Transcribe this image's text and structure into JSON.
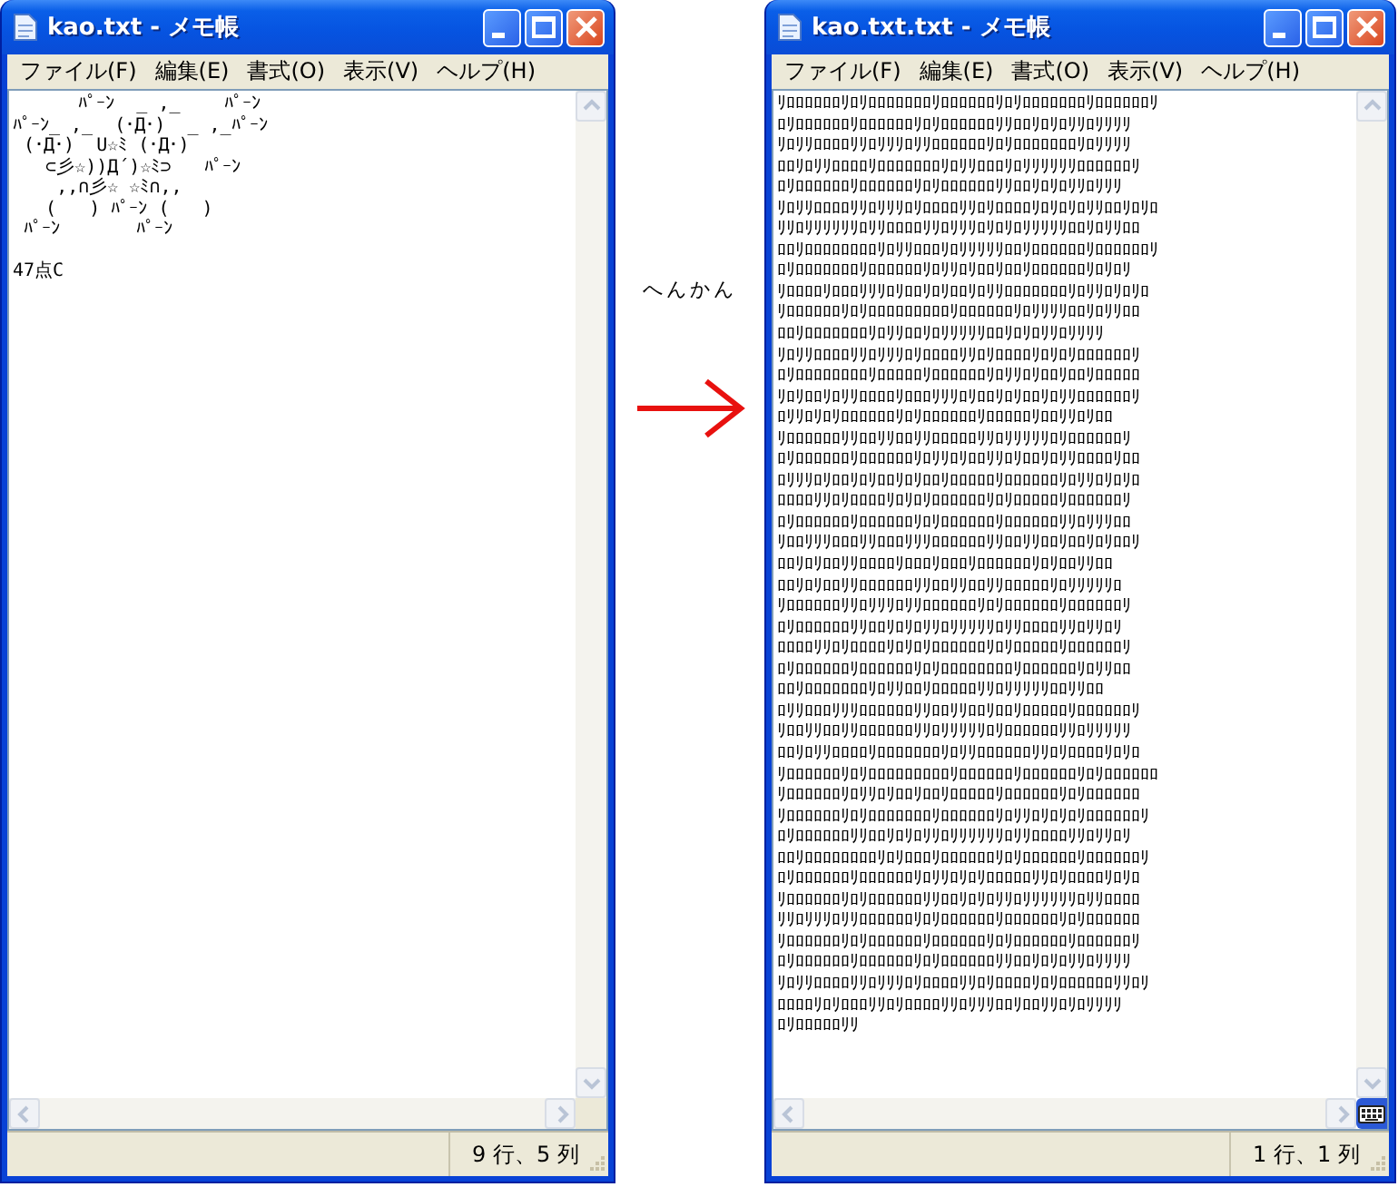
{
  "windows": [
    {
      "title": "kao.txt - メモ帳",
      "menu": [
        "ファイル(F)",
        "編集(E)",
        "書式(O)",
        "表示(V)",
        "ヘルプ(H)"
      ],
      "paragraphs": [
        [
          "      ﾊﾟｰﾝ  _ ,_    ﾊﾟｰﾝ",
          "ﾊﾟｰﾝ_ ,_  (･Д･)  _ ,_ﾊﾟｰﾝ",
          " (･Д･)  U☆ﾐ (･Д･)",
          "   ⊂彡☆))Д´)☆ﾐ⊃   ﾊﾟｰﾝ",
          "    ,,∩彡☆ ☆ﾐ∩,,",
          "   (   ) ﾊﾟｰﾝ (   )",
          " ﾊﾟｰﾝ       ﾊﾟｰﾝ"
        ],
        [
          "47点C"
        ]
      ],
      "status": "9 行、5 列",
      "language_bar": false
    },
    {
      "title": "kao.txt.txt - メモ帳",
      "menu": [
        "ファイル(F)",
        "編集(E)",
        "書式(O)",
        "表示(V)",
        "ヘルプ(H)"
      ],
      "paragraphs": [
        [
          "ﾘﾛﾛﾛﾛﾛﾛﾘﾛﾘﾛﾛﾛﾛﾛﾛﾛﾘﾛﾛﾛﾛﾛﾛﾘﾛﾘﾛﾛﾛﾛﾛﾛﾛﾘﾛﾛﾛﾛﾛﾛﾘ",
          "ﾛﾘﾛﾛﾛﾛﾛﾛﾘﾛﾛﾛﾛﾛﾛﾘﾛﾘﾛﾛﾛﾛﾛﾛﾘﾘﾛﾛﾘﾛﾘﾛﾘﾘﾛﾘﾘﾘﾘ",
          "ﾘﾛﾘﾘﾛﾛﾛﾛﾘﾘﾛﾘﾘﾘﾛﾘﾘﾛﾛﾛﾛﾛﾛﾘﾛﾘﾛﾛﾛﾛﾛﾛﾛﾘﾛﾘﾘﾘﾘ",
          "ﾛﾛﾘﾛﾘﾘﾛﾛﾛﾛﾘﾛﾛﾛﾛﾛﾛﾛﾘﾛﾘﾘﾛﾛﾛﾘﾛﾘﾘﾘﾘﾘﾘﾛﾛﾛﾛﾛﾛﾘ",
          "ﾛﾘﾛﾛﾛﾛﾛﾛﾘﾛﾛﾛﾛﾛﾛﾘﾛﾘﾛﾛﾛﾛﾛﾛﾘﾘﾛﾛﾘﾛﾘﾛﾘﾘﾛﾘﾘﾘ",
          "ﾘﾛﾘﾘﾛﾛﾛﾛﾘﾘﾛﾘﾘﾘﾛﾘﾛﾛﾛﾛﾘﾘﾛﾘﾛﾛﾛﾛﾘﾛﾘﾛﾘﾛﾘﾘﾛﾛﾘﾛﾘﾛ",
          "ﾘﾘﾛﾘﾘﾘﾘﾘﾘﾛﾘﾘﾛﾛﾛﾛﾘﾘﾛﾘﾘﾘﾛﾘﾛﾘﾛﾘﾘﾘﾘﾘﾛﾛﾘﾛﾘﾘﾛﾛ",
          "ﾛﾛﾘﾛﾛﾛﾛﾛﾛﾛﾛﾘﾛﾘﾘﾛﾛﾛﾘﾛﾘﾘﾘﾘﾘﾛﾛﾘﾛﾛﾛﾛﾛﾛﾘﾛﾛﾛﾛﾛﾛﾘ",
          "ﾛﾘﾛﾛﾛﾛﾛﾛﾛﾘﾛﾛﾛﾛﾛﾛﾘﾛﾘﾘﾛﾘﾛﾛﾘﾛﾛﾘﾛﾛﾛﾛﾛﾛﾘﾛﾘﾛﾘ",
          "ﾘﾛﾛﾛﾛﾘﾛﾛﾛﾘﾘﾘﾛﾘﾛﾛﾘﾛﾘﾛﾛﾘﾛﾘﾘﾛﾛﾛﾛﾛﾛﾛﾘﾛﾘﾘﾛﾘﾛﾘﾛ",
          "ﾘﾛﾛﾛﾛﾛﾛﾘﾛﾘﾛﾛﾛﾛﾛﾛﾛﾛﾛﾘﾛﾛﾛﾛﾛﾛﾘﾛﾘﾘﾘﾘﾛﾛﾘﾛﾘﾘﾛﾛ",
          "ﾛﾛﾘﾛﾛﾛﾛﾛﾛﾛﾘﾛﾘﾘﾛﾛﾘﾛﾘﾘﾘﾘﾘﾛﾛﾘﾛﾘﾛﾘﾘﾛﾘﾘﾘﾘ",
          "ﾘﾛﾘﾘﾛﾛﾛﾛﾘﾘﾛﾘﾘﾘﾛﾘﾛﾛﾛﾛﾘﾘﾛﾘﾛﾛﾛﾛﾘﾛﾘﾛﾘﾛﾛﾛﾛﾛﾛﾘ",
          "ﾛﾘﾛﾛﾛﾛﾛﾛﾛﾛﾘﾛﾛﾛﾛﾛﾘﾛﾛﾛﾛﾛﾛﾘﾛﾘﾘﾛﾘﾛﾛﾘﾛﾛﾘﾛﾛﾛﾛﾛ",
          "ﾘﾛﾘﾛﾛﾘﾛﾘﾘﾛﾛﾛﾛﾘﾛﾛﾛﾘﾘﾘﾛﾘﾛﾛﾘﾛﾘﾛﾛﾘﾛﾘﾘﾛﾛﾛﾛﾛﾛﾘ",
          "ﾛﾘﾘﾛﾘﾛﾘﾛﾛﾛﾛﾛﾛﾘﾛﾘﾛﾛﾛﾛﾛﾛﾘﾛﾛﾛﾛﾛﾘﾛﾛﾘﾘﾛﾘﾛﾛ",
          "ﾘﾛﾛﾛﾛﾛﾛﾘﾘﾛﾛﾘﾘﾛﾛﾘﾘﾛﾛﾛﾛﾛﾘﾘﾛﾘﾘﾘﾘﾘﾛﾘﾛﾛﾛﾛﾛﾛﾘ",
          "ﾛﾘﾛﾛﾛﾛﾛﾛﾘﾛﾛﾛﾛﾛﾛﾘﾛﾘﾘﾛﾘﾛﾛﾘﾘﾛﾘﾛﾛﾘﾛﾘﾘﾛﾛﾛﾛﾘﾛﾛ",
          "ﾛﾘﾘﾘﾛﾘﾛﾛﾘﾛﾘﾛﾛﾘﾛﾘﾛﾛﾘﾛﾛﾛﾛﾛﾘﾛﾛﾛﾛﾛﾛﾘﾛﾘﾘﾛﾘﾛﾘﾛ",
          "ﾛﾛﾛﾛﾘﾘﾛﾘﾛﾛﾛﾛﾘﾛﾘﾛﾘﾛﾛﾛﾛﾛﾛﾘﾛﾘﾛﾛﾛﾛﾛﾘﾛﾛﾛﾛﾛﾛﾘ",
          "ﾛﾘﾛﾛﾛﾛﾛﾛﾘﾛﾛﾛﾛﾛﾛﾘﾛﾘﾛﾛﾛﾛﾛﾛﾘﾛﾛﾛﾛﾛﾛﾘﾘﾛﾘﾘﾘﾛﾛ",
          "ﾘﾛﾛﾘﾘﾘﾛﾛﾛﾘﾘﾛﾛﾛﾘﾘﾘﾛﾛﾛﾛﾛﾛﾘﾘﾛﾛﾘﾘﾛﾛﾘﾛﾛﾘﾛﾘﾛﾛﾘ",
          "ﾛﾛﾘﾛﾘﾛﾛﾘﾘﾛﾛﾛﾛﾘﾛﾛﾛﾘﾛﾛﾛﾘﾛﾛﾛﾛﾛﾛﾘﾛﾘﾛﾛﾘﾘﾛﾛ",
          "ﾛﾛﾘﾛﾘﾛﾛﾘﾘﾛﾛﾛﾛﾛﾛﾘﾘﾛﾛﾘﾘﾛﾛﾘﾘﾛﾛﾛﾛﾛﾘﾛﾘﾘﾘﾘﾘﾛ",
          "ﾘﾛﾛﾛﾛﾛﾛﾘﾘﾛﾘﾘﾘﾛﾘﾘﾛﾛﾛﾛﾛﾛﾘﾛﾘﾛﾛﾛﾛﾛﾛﾘﾛﾛﾛﾛﾛﾛﾘ",
          "ﾛﾘﾛﾛﾛﾛﾛﾛﾘﾘﾛﾛﾘﾛﾘﾛﾘﾘﾛﾘﾘﾘﾘﾘﾛﾘﾘﾛﾛﾛﾛﾘﾘﾛﾘﾘﾛﾘ",
          "ﾛﾛﾛﾛﾘﾘﾛﾘﾛﾛﾛﾛﾘﾛﾘﾛﾘﾛﾛﾛﾛﾛﾛﾘﾛﾘﾛﾛﾛﾛﾛﾘﾛﾛﾛﾛﾛﾛﾘ",
          "ﾛﾘﾛﾛﾛﾛﾛﾛﾘﾛﾛﾛﾛﾛﾛﾘﾛﾘﾛﾛﾛﾛﾛﾛﾛﾛﾘﾛﾛﾛﾛﾛﾛﾘﾛﾘﾘﾛﾛ",
          "ﾛﾛﾘﾛﾛﾛﾛﾛﾛﾛﾘﾛﾘﾘﾛﾛﾘﾛﾛﾛﾛﾛﾘﾘﾛﾘﾘﾘﾘﾘﾛﾛﾘﾘﾛﾛ",
          "ﾛﾘﾘﾛﾛﾛﾘﾘﾘﾛﾛﾛﾛﾛﾛﾘﾘﾛﾛﾘﾘﾛﾛﾘﾛﾛﾘﾛﾛﾛﾛﾛﾘﾛﾛﾛﾛﾛﾛﾘ",
          "ﾘﾛﾛﾘﾘﾛﾛﾘﾘﾛﾛﾛﾛﾛﾛﾘﾘﾛﾘﾘﾘﾘﾘﾛﾘﾛﾛﾛﾛﾛﾛﾘﾘﾛﾘﾘﾘﾘﾘ",
          "ﾛﾛﾘﾛﾘﾘﾛﾛﾛﾛﾘﾛﾛﾛﾛﾛﾛﾛﾘﾛﾘﾘﾛﾛﾛﾛﾛﾛﾘﾘﾛﾘﾛﾛﾛﾛﾘﾛﾘﾛ",
          "ﾘﾛﾛﾛﾛﾛﾛﾘﾛﾘﾛﾛﾛﾛﾛﾛﾛﾛﾛﾘﾛﾛﾛﾛﾛﾛﾘﾛﾛﾛﾛﾛﾛﾘﾛﾘﾛﾛﾛﾛﾛﾛ",
          "ﾘﾛﾛﾛﾛﾛﾛﾘﾛﾘﾘﾛﾘﾛﾛﾘﾛﾛﾘﾛﾛﾛﾛﾛﾘﾛﾛﾛﾛﾛﾛﾘﾛﾘﾛﾛﾛﾛﾛﾛ",
          "ﾘﾛﾛﾛﾛﾛﾛﾘﾛﾘﾛﾛﾛﾛﾛﾛﾛﾘﾛﾛﾛﾛﾛﾛﾘﾛﾘﾘﾛﾘﾛﾘﾛﾘﾛﾛﾛﾛﾛﾛﾘ",
          "ﾛﾘﾛﾛﾛﾛﾛﾛﾘﾘﾛﾛﾘﾛﾘﾛﾘﾘﾛﾘﾘﾘﾘﾘﾘﾛﾘﾘﾛﾛﾛﾛﾘﾘﾛﾘﾘﾛﾘ",
          "ﾛﾛﾘﾛﾛﾛﾛﾛﾛﾛﾛﾘﾛﾘﾛﾛﾛﾘﾛﾛﾛﾛﾛﾛﾘﾛﾘﾛﾛﾛﾛﾛﾛﾘﾛﾛﾛﾛﾛﾛﾘ",
          "ﾛﾘﾛﾛﾛﾛﾛﾛﾘﾛﾛﾛﾛﾛﾛﾘﾛﾘﾘﾛﾘﾛﾘﾛﾛﾛﾛﾛﾘﾘﾛﾘﾛﾛﾛﾛﾘﾛﾘﾛ",
          "ﾘﾛﾛﾛﾛﾛﾛﾘﾛﾘﾛﾛﾛﾛﾛﾛﾘﾘﾛﾛﾘﾛﾘﾛﾘﾘﾛﾘﾘﾘﾘﾘﾘﾛﾘﾘﾛﾛﾛﾛ",
          "ﾘﾘﾛﾘﾘﾘﾛﾘﾘﾛﾛﾛﾛﾛﾛﾘﾛﾘﾛﾛﾛﾛﾛﾛﾘﾛﾛﾛﾛﾛﾛﾘﾛﾘﾛﾛﾛﾛﾛﾛ",
          "ﾘﾛﾛﾛﾛﾛﾛﾘﾛﾘﾛﾛﾛﾛﾛﾛﾘﾛﾛﾛﾛﾛﾛﾘﾛﾘﾛﾛﾛﾛﾛﾛﾘﾛﾛﾛﾛﾛﾛﾘ",
          "ﾛﾘﾛﾛﾛﾛﾛﾛﾘﾛﾛﾛﾛﾛﾛﾘﾛﾘﾛﾛﾛﾛﾛﾛﾘﾘﾛﾛﾘﾛﾘﾛﾘﾘﾛﾘﾘﾘﾘ",
          "ﾘﾛﾘﾘﾛﾛﾛﾛﾘﾘﾛﾘﾘﾘﾛﾘﾛﾛﾛﾛﾘﾘﾛﾘﾛﾛﾛﾛﾘﾛﾘﾛﾛﾛﾛﾛﾛﾘﾘﾛﾘ",
          "ﾛﾛﾛﾛﾘﾛﾘﾛﾛﾛﾘﾘﾛﾘﾛﾛﾛﾛﾘﾘﾛﾘﾘﾘﾛﾛﾘﾛﾛﾘﾘﾛﾘﾛﾘﾘﾘﾘ",
          "ﾛﾘﾛﾛﾛﾛﾛﾘﾘ"
        ]
      ],
      "status": "1 行、1 列",
      "language_bar": true
    }
  ],
  "annotation": {
    "label": "へんかん"
  }
}
